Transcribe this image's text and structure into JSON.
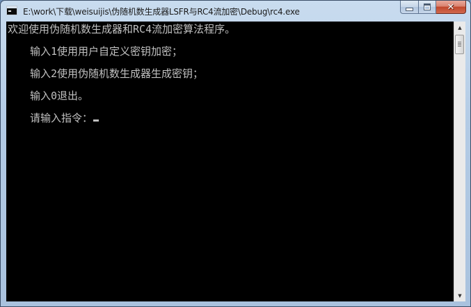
{
  "window": {
    "title": "E:\\work\\下载\\weisuijis\\伪随机数生成器LSFR与RC4流加密\\Debug\\rc4.exe",
    "app_icon": "console-icon",
    "buttons": {
      "minimize_icon": "minimize-icon",
      "maximize_icon": "maximize-icon",
      "close_icon": "close-icon",
      "close_glyph": "✕"
    }
  },
  "console": {
    "background_color": "#000000",
    "text_color": "#c0c0c0",
    "lines": [
      "欢迎使用伪随机数生成器和RC4流加密算法程序。",
      "输入1使用用户自定义密钥加密；",
      "输入2使用伪随机数生成器生成密钥；",
      "输入0退出。",
      "请输入指令："
    ]
  },
  "scrollbar": {
    "up_glyph": "▲",
    "down_glyph": "▼"
  }
}
